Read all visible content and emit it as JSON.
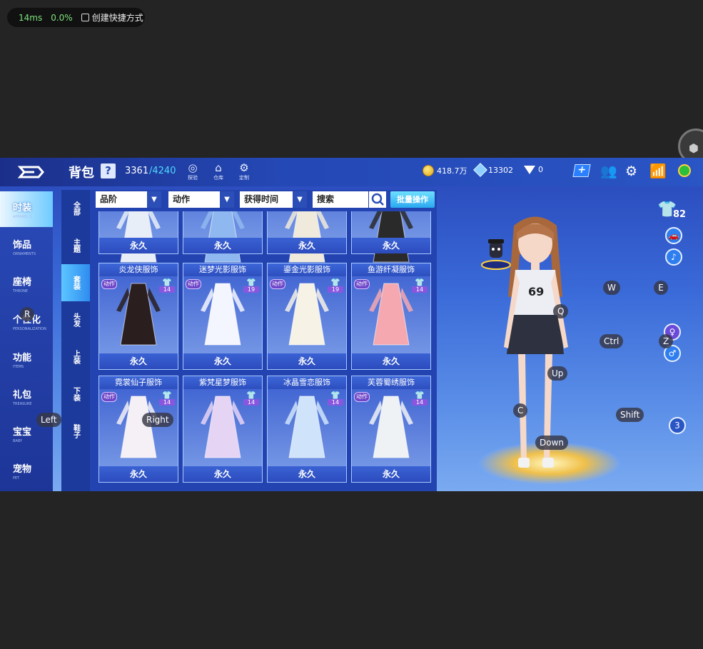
{
  "overlay": {
    "latency": "14ms",
    "loss": "0.0%",
    "shortcut": "创建快捷方式"
  },
  "header": {
    "title": "背包",
    "help": "?",
    "capacity_used": "3361",
    "capacity_total": "/4240",
    "icons": [
      {
        "name": "explore-icon",
        "label": "探验"
      },
      {
        "name": "warehouse-icon",
        "label": "仓库"
      },
      {
        "name": "custom-icon",
        "label": "定制"
      }
    ],
    "currency": {
      "coins": "418.7万",
      "points": "13302",
      "diamonds": "0"
    }
  },
  "nav": [
    {
      "zh": "时装",
      "en": "APPAREL S"
    },
    {
      "zh": "饰品",
      "en": "ORNAMENTS"
    },
    {
      "zh": "座椅",
      "en": "THRONE"
    },
    {
      "zh": "个性化",
      "en": "PERSONALIZATION"
    },
    {
      "zh": "功能",
      "en": "ITEMS"
    },
    {
      "zh": "礼包",
      "en": "TREASURE"
    },
    {
      "zh": "宝宝",
      "en": "BABY"
    },
    {
      "zh": "宠物",
      "en": "PET"
    }
  ],
  "subnav": [
    "全部",
    "主题",
    "套装",
    "头发",
    "上装",
    "下装",
    "鞋子"
  ],
  "filters": {
    "grade": "品阶",
    "action": "动作",
    "time": "获得时间",
    "search_placeholder": "搜索",
    "batch": "批量操作"
  },
  "items": [
    {
      "name": "",
      "duration": "永久",
      "action": "",
      "count": "",
      "color": "#e8eef8"
    },
    {
      "name": "",
      "duration": "永久",
      "action": "",
      "count": "",
      "color": "#8fb8f0"
    },
    {
      "name": "",
      "duration": "永久",
      "action": "",
      "count": "",
      "color": "#f0eadc"
    },
    {
      "name": "",
      "duration": "永久",
      "action": "",
      "count": "",
      "color": "#2a2a2a"
    },
    {
      "name": "炎龙侠服饰",
      "duration": "永久",
      "action": "动作",
      "count": "14",
      "color": "#2a1e1e"
    },
    {
      "name": "迷梦光影服饰",
      "duration": "永久",
      "action": "动作",
      "count": "19",
      "color": "#f4f6ff"
    },
    {
      "name": "鎏金光影服饰",
      "duration": "永久",
      "action": "动作",
      "count": "19",
      "color": "#f6f2e6"
    },
    {
      "name": "鱼游纤凝服饰",
      "duration": "永久",
      "action": "动作",
      "count": "14",
      "color": "#f6a8b0"
    },
    {
      "name": "霓裳仙子服饰",
      "duration": "永久",
      "action": "动作",
      "count": "14",
      "color": "#f4f0f6"
    },
    {
      "name": "紫梵星梦服饰",
      "duration": "永久",
      "action": "",
      "count": "14",
      "color": "#e6d4f4"
    },
    {
      "name": "冰晶雪恋服饰",
      "duration": "永久",
      "action": "",
      "count": "14",
      "color": "#cfe4fa"
    },
    {
      "name": "芙蓉蜀绣服饰",
      "duration": "永久",
      "action": "动作",
      "count": "14",
      "color": "#eef2f4"
    }
  ],
  "wardrobe_count": "82",
  "side_badge": "3",
  "keys": [
    "R",
    "Left",
    "Right",
    "W",
    "E",
    "Q",
    "Ctrl",
    "Z",
    "Up",
    "C",
    "Shift",
    "Down"
  ],
  "accent": "#2a55c4"
}
